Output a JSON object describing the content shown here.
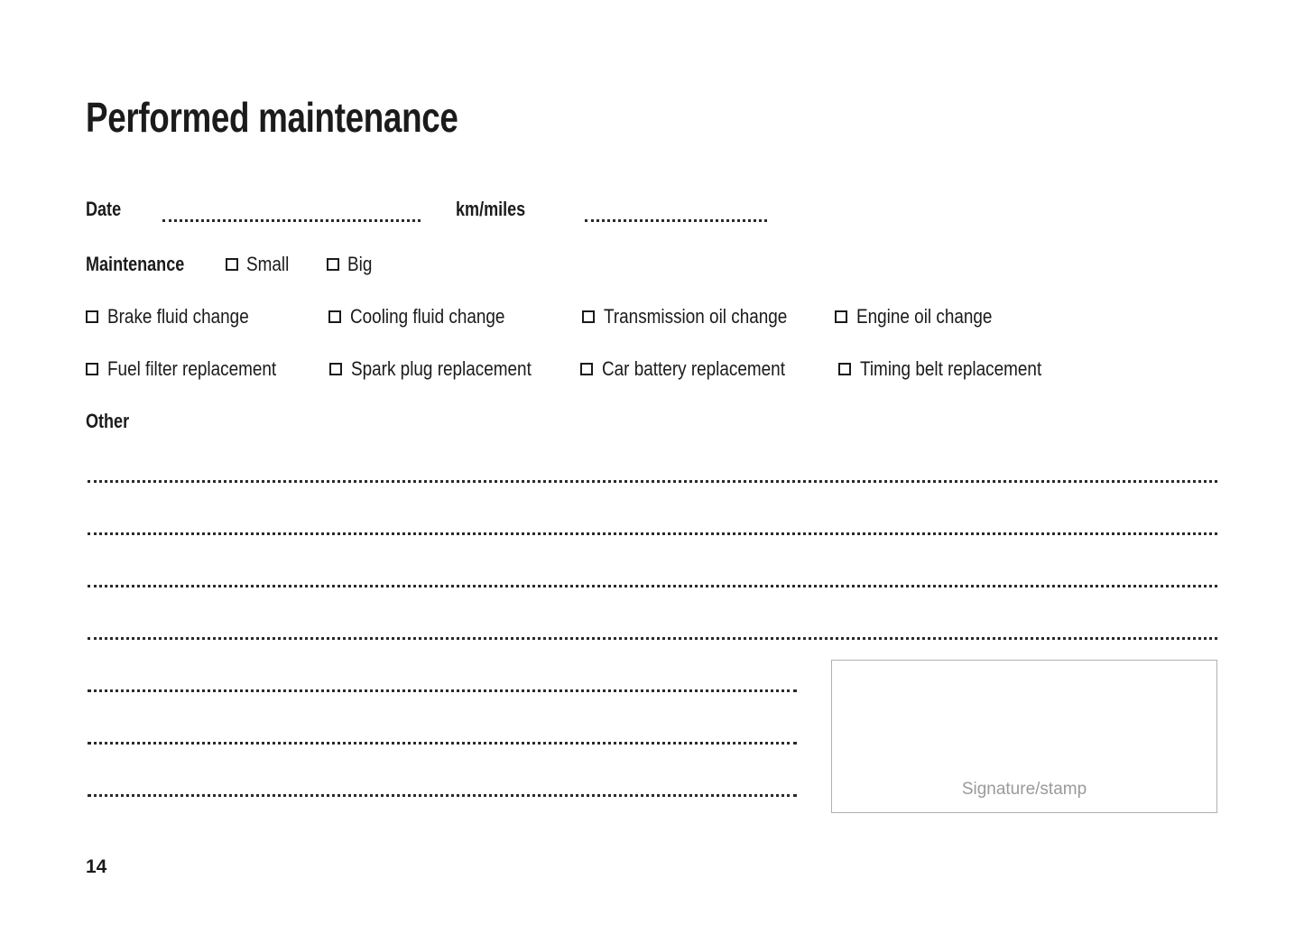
{
  "document": {
    "title": "Performed maintenance",
    "page_number": "14"
  },
  "fields": {
    "date_label": "Date",
    "date_value": "",
    "km_label": "km/miles",
    "km_value": ""
  },
  "maintenance": {
    "label": "Maintenance",
    "options": [
      {
        "label": "Small",
        "checked": false
      },
      {
        "label": "Big",
        "checked": false
      }
    ]
  },
  "tasks": {
    "row1": [
      {
        "label": "Brake fluid change",
        "checked": false
      },
      {
        "label": "Cooling fluid change",
        "checked": false
      },
      {
        "label": "Transmission oil change",
        "checked": false
      },
      {
        "label": "Engine oil change",
        "checked": false
      }
    ],
    "row2": [
      {
        "label": "Fuel filter replacement",
        "checked": false
      },
      {
        "label": "Spark plug replacement",
        "checked": false
      },
      {
        "label": "Car battery replacement",
        "checked": false
      },
      {
        "label": "Timing belt replacement",
        "checked": false
      }
    ]
  },
  "other": {
    "label": "Other",
    "lines": [
      "",
      "",
      "",
      "",
      "",
      "",
      ""
    ]
  },
  "signature": {
    "label": "Signature/stamp",
    "value": ""
  },
  "colors": {
    "ink": "#1b1b1b",
    "rule": "#2a2a2a",
    "box_border": "#b0b0b0",
    "muted_text": "#9a9a9a",
    "background": "#ffffff"
  }
}
